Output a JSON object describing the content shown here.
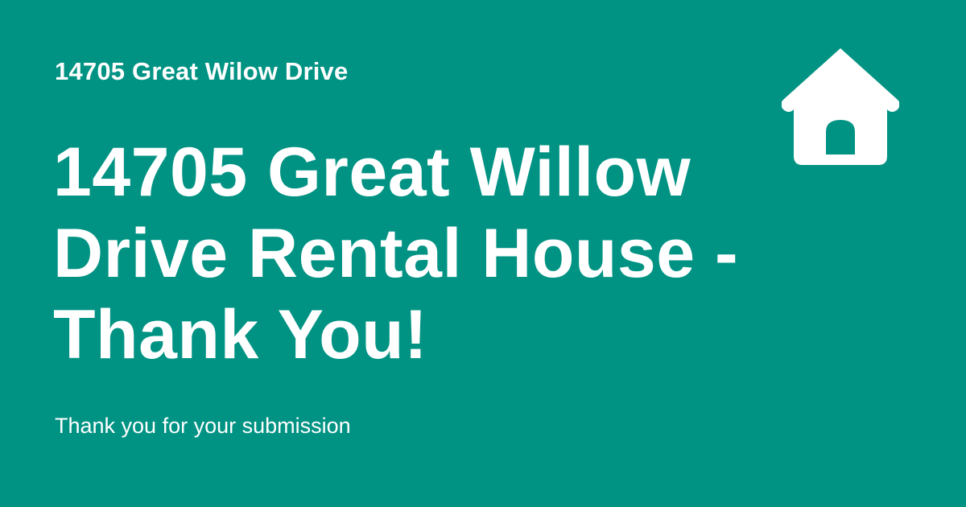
{
  "card": {
    "eyebrow": "14705 Great Wilow Drive",
    "title": "14705 Great Willow Drive Rental House - Thank You!",
    "subtitle": "Thank you for your submission",
    "icon": "house-icon"
  },
  "colors": {
    "background": "#009383",
    "text": "#ffffff"
  }
}
